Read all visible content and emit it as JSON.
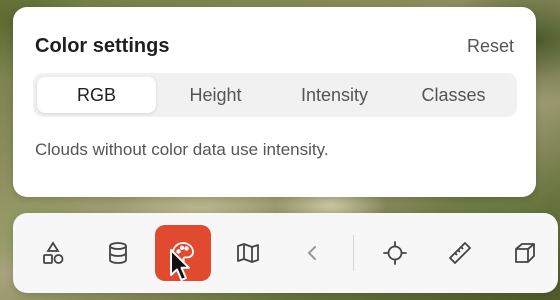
{
  "panel": {
    "title": "Color settings",
    "reset_label": "Reset",
    "modes": [
      "RGB",
      "Height",
      "Intensity",
      "Classes"
    ],
    "active_mode": "RGB",
    "hint": "Clouds without color data use intensity."
  },
  "toolbar": {
    "tools": [
      {
        "icon": "shapes-icon"
      },
      {
        "icon": "database-icon"
      },
      {
        "icon": "palette-icon",
        "active": true
      },
      {
        "icon": "map-icon"
      },
      {
        "icon": "chevron-left-icon"
      },
      {
        "icon": "crosshair-icon"
      },
      {
        "icon": "ruler-icon"
      },
      {
        "icon": "cube-icon"
      }
    ],
    "active_color": "#e04a2f"
  }
}
